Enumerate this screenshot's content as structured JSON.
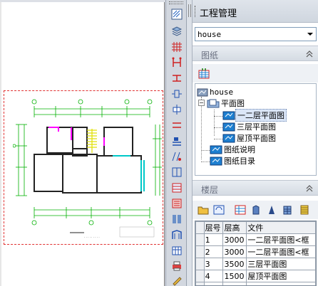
{
  "panel": {
    "title": "工程管理",
    "project_select_value": "house"
  },
  "drawings": {
    "header": "图纸",
    "tree": {
      "root": "house",
      "plan_folder": "平面图",
      "plans": [
        "一二层平面图",
        "三层平面图",
        "屋顶平面图"
      ],
      "notes": "图纸说明",
      "catalog": "图纸目录"
    }
  },
  "floors": {
    "header": "楼层",
    "columns": [
      "层号",
      "层高",
      "文件"
    ],
    "rows": [
      {
        "no": "1",
        "height": "3000",
        "file": "一二层平面图<框"
      },
      {
        "no": "2",
        "height": "3000",
        "file": "一二层平面图<框"
      },
      {
        "no": "3",
        "height": "3500",
        "file": "三层平面图"
      },
      {
        "no": "4",
        "height": "1500",
        "file": "屋顶平面图"
      }
    ]
  },
  "colors": {
    "accent_green": "#00c000",
    "wall_red": "#e03030",
    "selection": "#dbe6f7"
  },
  "icons": [
    "hatch-icon",
    "layer-icon",
    "grid-axis-icon",
    "column-icon",
    "wall-icon",
    "door-icon",
    "window-icon",
    "stair-icon",
    "room-icon",
    "dimension-icon",
    "text-icon",
    "table-icon",
    "elevation-icon",
    "section-icon",
    "3d-model-icon",
    "print-icon",
    "pencil-icon"
  ]
}
